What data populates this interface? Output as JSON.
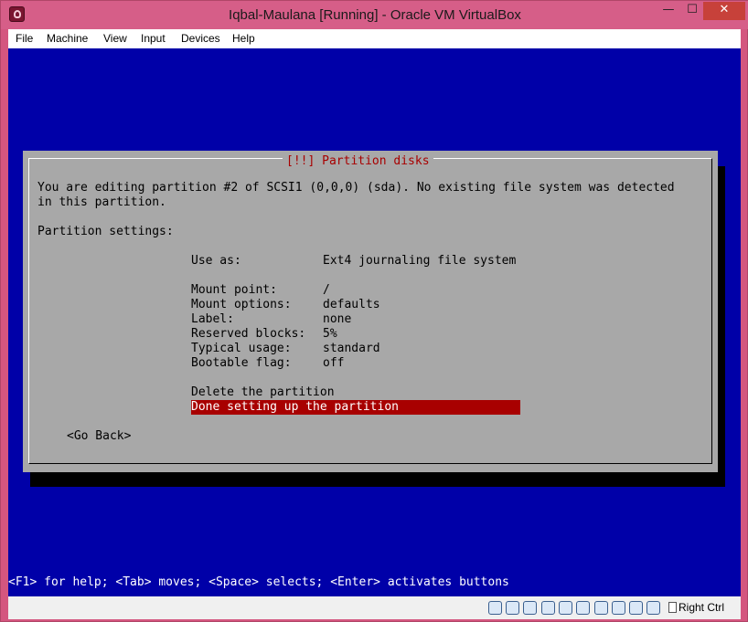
{
  "window": {
    "title": "Iqbal-Maulana [Running] - Oracle VM VirtualBox",
    "minimize_glyph": "—",
    "maximize_glyph": "☐",
    "close_glyph": "✕"
  },
  "menu": {
    "items": [
      "File",
      "Machine",
      "View",
      "Input",
      "Devices",
      "Help"
    ]
  },
  "dialog": {
    "title": "[!!] Partition disks",
    "intro_line1": "You are editing partition #2 of SCSI1 (0,0,0) (sda). No existing file system was detected",
    "intro_line2": "in this partition.",
    "section_heading": "Partition settings:",
    "settings": [
      {
        "label": "Use as:",
        "value": "Ext4 journaling file system"
      },
      {
        "label": "Mount point:",
        "value": "/"
      },
      {
        "label": "Mount options:",
        "value": "defaults"
      },
      {
        "label": "Label:",
        "value": "none"
      },
      {
        "label": "Reserved blocks:",
        "value": "5%"
      },
      {
        "label": "Typical usage:",
        "value": "standard"
      },
      {
        "label": "Bootable flag:",
        "value": "off"
      }
    ],
    "actions": {
      "delete": "Delete the partition",
      "done": "Done setting up the partition"
    },
    "go_back": "<Go Back>"
  },
  "footer": {
    "help_text": "<F1> for help; <Tab> moves; <Space> selects; <Enter> activates buttons"
  },
  "statusbar": {
    "icons": [
      "hard-disk-icon",
      "optical-drive-icon",
      "usb-icon",
      "network-icon",
      "shared-folders-icon",
      "display-icon",
      "video-capture-icon",
      "keyboard-icon",
      "mouse-integration-icon",
      "arrow-icon"
    ],
    "host_key": "Right Ctrl"
  },
  "colors": {
    "screen_bg": "#0000a8",
    "dialog_bg": "#a8a8a8",
    "highlight": "#a80000",
    "window_frame": "#d65e88"
  }
}
